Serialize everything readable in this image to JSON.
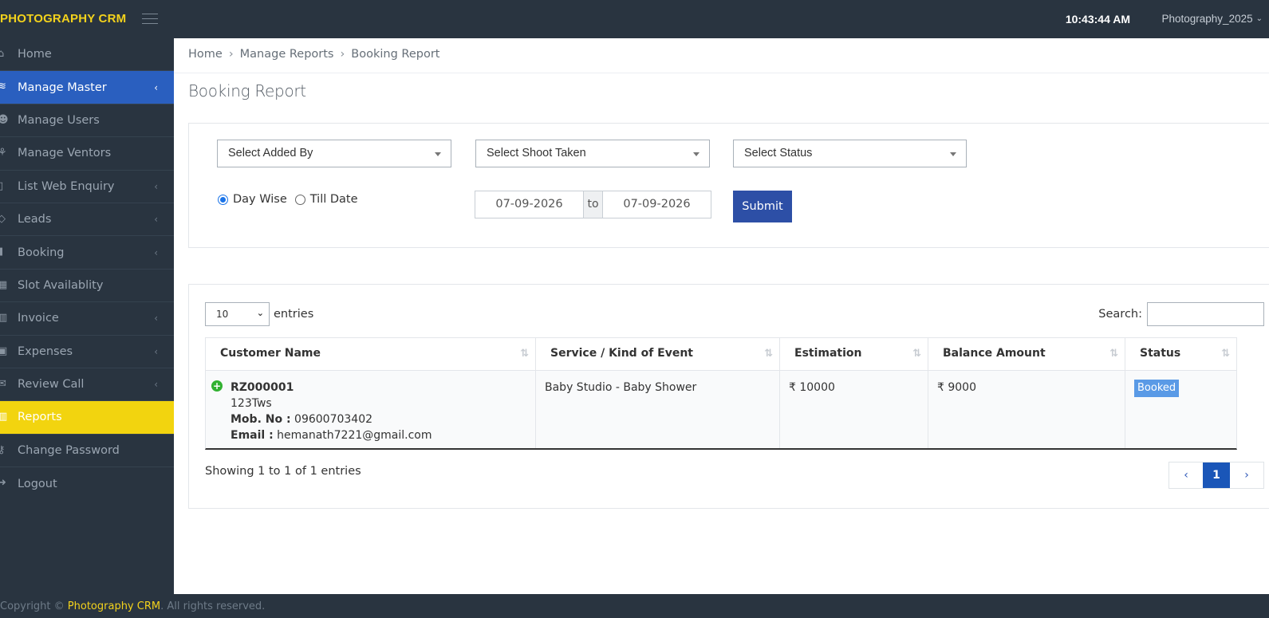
{
  "app": {
    "brand": "PHOTOGRAPHY CRM",
    "time": "10:43:44 AM",
    "user": "Photography_2025"
  },
  "sidebar": {
    "items": [
      {
        "label": "Home",
        "icon": "home-icon",
        "chevron": false,
        "state": "normal"
      },
      {
        "label": "Manage Master",
        "icon": "layers-icon",
        "chevron": true,
        "state": "active-blue"
      },
      {
        "label": "Manage Users",
        "icon": "users-icon",
        "chevron": false,
        "state": "normal"
      },
      {
        "label": "Manage Ventors",
        "icon": "vendors-icon",
        "chevron": false,
        "state": "normal"
      },
      {
        "label": "List Web Enquiry",
        "icon": "list-icon",
        "chevron": true,
        "state": "normal"
      },
      {
        "label": "Leads",
        "icon": "diamond-icon",
        "chevron": true,
        "state": "normal"
      },
      {
        "label": "Booking",
        "icon": "bookmark-icon",
        "chevron": true,
        "state": "normal"
      },
      {
        "label": "Slot Availablity",
        "icon": "calendar-icon",
        "chevron": false,
        "state": "normal"
      },
      {
        "label": "Invoice",
        "icon": "bar-chart-icon",
        "chevron": true,
        "state": "normal"
      },
      {
        "label": "Expenses",
        "icon": "money-icon",
        "chevron": true,
        "state": "normal"
      },
      {
        "label": "Review Call",
        "icon": "chat-icon",
        "chevron": true,
        "state": "normal"
      },
      {
        "label": "Reports",
        "icon": "report-chart-icon",
        "chevron": false,
        "state": "active-yellow"
      },
      {
        "label": "Change Password",
        "icon": "key-icon",
        "chevron": false,
        "state": "normal"
      },
      {
        "label": "Logout",
        "icon": "logout-icon",
        "chevron": false,
        "state": "normal"
      }
    ]
  },
  "breadcrumb": {
    "home": "Home",
    "sep": "›",
    "section": "Manage Reports",
    "current": "Booking Report"
  },
  "page_title": "Booking Report",
  "filters": {
    "added_by": "Select Added By",
    "shoot_taken": "Select Shoot Taken",
    "status": "Select Status",
    "day_wise": "Day Wise",
    "till_date": "Till Date",
    "selected_mode": "Day Wise",
    "from_date": "07-09-2026",
    "to_label": "to",
    "to_date": "07-09-2026",
    "submit": "Submit"
  },
  "table_controls": {
    "length_value": "10",
    "entries_label": "entries",
    "search_label": "Search:",
    "search_value": ""
  },
  "table": {
    "headers": [
      "Customer Name",
      "Service / Kind of Event",
      "Estimation",
      "Balance Amount",
      "Status"
    ],
    "rows": [
      {
        "id": "RZ000001",
        "name": "123Tws",
        "mob_label": "Mob. No :",
        "mob": "09600703402",
        "email_label": "Email :",
        "email": "hemanath7221@gmail.com",
        "service": "Baby Studio - Baby Shower",
        "estimation": "₹ 10000",
        "balance": "₹ 9000",
        "status": "Booked"
      }
    ]
  },
  "pagination": {
    "info": "Showing 1 to 1 of 1 entries",
    "prev": "‹",
    "current": "1",
    "next": "›"
  },
  "footer": {
    "prefix": "Copyright © ",
    "link": "Photography CRM",
    "suffix": ". All rights reserved."
  },
  "colors": {
    "topbar": "#293440",
    "brand": "#f3d21c",
    "active_blue": "#2a5fbf",
    "active_yellow": "#f2d40f",
    "submit": "#2d4fa6",
    "badge": "#5a9ae6",
    "plus_green": "#31b131"
  }
}
